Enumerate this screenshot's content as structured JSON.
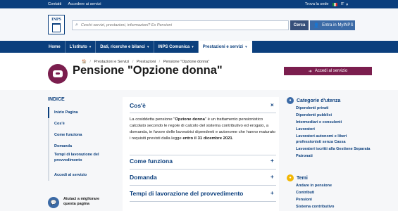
{
  "topbar": {
    "left": [
      "Contatti",
      "Accedere ai servizi"
    ],
    "trova": "Trova la sede",
    "lang": "IT"
  },
  "header": {
    "logo_text": "INPS",
    "search_placeholder": "Cerchi servizi, prestazioni, informazioni? Es Pensioni",
    "search_button": "Cerca",
    "mypage_button": "Entra in MyINPS"
  },
  "nav": {
    "items": [
      "Home",
      "L'istituto",
      "Dati, ricerche e bilanci",
      "INPS Comunica",
      "Prestazioni e servizi"
    ]
  },
  "breadcrumb": [
    "Prestazioni e Servizi",
    "Prestazioni",
    "Pensione \"Opzione donna\""
  ],
  "page": {
    "title": "Pensione \"Opzione donna\"",
    "access_button": "Accedi al servizio"
  },
  "indice": {
    "header": "INDICE",
    "items": [
      "Inizio Pagina",
      "Cos'è",
      "Come funziona",
      "Domanda",
      "Tempi di lavorazione del provvedimento",
      "Accedi al servizio"
    ]
  },
  "help": {
    "text": "Aiutaci a migliorare questa pagina"
  },
  "main": {
    "cose": {
      "title": "Cos'è",
      "toggle": "×",
      "p1": "La cosiddetta pensione \"",
      "p1_bold": "Opzione donna",
      "p2": "\" è un trattamento pensionistico calcolato secondo le regole di calcolo del sistema contributivo ed erogato, a domanda, in favore delle lavoratrici dipendenti e autonome che hanno maturato i requisiti previsti dalla legge ",
      "p2_bold": "entro il 31 dicembre 2021",
      "p3": "."
    },
    "sections": [
      {
        "title": "Come funziona",
        "toggle": "+"
      },
      {
        "title": "Domanda",
        "toggle": "+"
      },
      {
        "title": "Tempi di lavorazione del provvedimento",
        "toggle": "+"
      }
    ]
  },
  "categorie": {
    "header": "Categorie d'utenza",
    "items": [
      "Dipendenti privati",
      "Dipendenti pubblici",
      "Intermediari e consulenti",
      "Lavoratori",
      "Lavoratori autonomi e liberi professionisti senza Cassa",
      "Lavoratori iscritti alla Gestione Separata",
      "Patronati"
    ]
  },
  "temi": {
    "header": "Temi",
    "items": [
      "Andare in pensione",
      "Contributi",
      "Pensioni",
      "Sistema contributivo"
    ]
  },
  "colors": {
    "primary": "#0b3f7d",
    "accent": "#7b1e4e",
    "categorie_dot": "#3b6aa6",
    "temi_dot": "#f2b705"
  }
}
